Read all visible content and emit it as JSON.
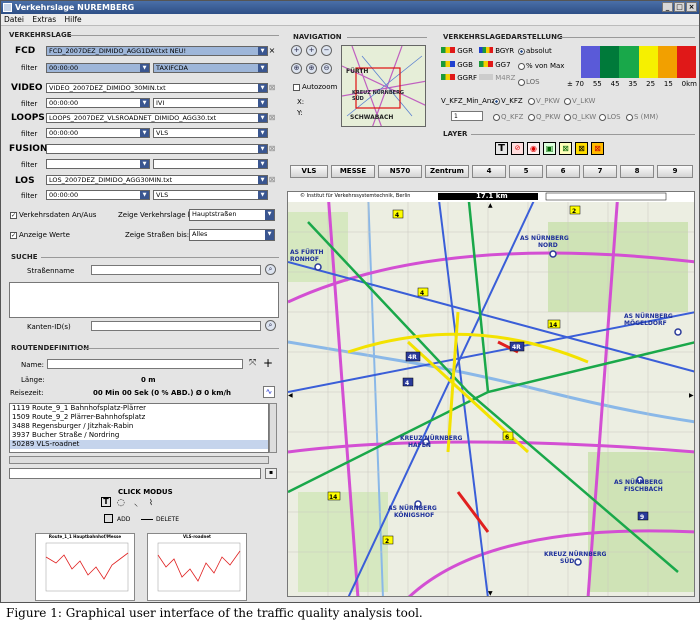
{
  "window": {
    "title": "Verkehrslage NUREMBERG",
    "min": "_",
    "max": "□",
    "close": "×"
  },
  "menu": [
    "Datei",
    "Extras",
    "Hilfe"
  ],
  "verkehrslage": {
    "title": "VERKEHRSLAGE",
    "fcd": {
      "label": "FCD",
      "source": "FCD_2007DEZ_DIMIDO_AGG1DAY.txt NEU!",
      "filter_label": "filter",
      "time": "00:00:00",
      "mode": "TAXIFCDA"
    },
    "video": {
      "label": "VIDEO",
      "source": "VIDEO_2007DEZ_DIMIDO_30MIN.txt",
      "filter_label": "filter",
      "time": "00:00:00",
      "mode": "IVI"
    },
    "loops": {
      "label": "LOOPS",
      "source": "LOOPS_2007DEZ_VLSROADNET_DIMIDO_AGG30.txt",
      "filter_label": "filter",
      "time": "00:00:00",
      "mode": "VLS"
    },
    "fusion": {
      "label": "FUSION",
      "source": "",
      "filter_label": "filter",
      "time": "",
      "mode": ""
    },
    "los": {
      "label": "LOS",
      "source": "LOS_2007DEZ_DIMIDO_AGG30MIN.txt",
      "filter_label": "filter",
      "time": "00:00:00",
      "mode": "VLS"
    },
    "show_data": "Verkehrsdaten An/Aus",
    "show_until_label": "Zeige Verkehrslage bis:",
    "show_until_value": "Hauptstraßen",
    "show_values": "Anzeige Werte",
    "show_roads_label": "Zeige Straßen bis:",
    "show_roads_value": "Alles"
  },
  "suche": {
    "title": "SUCHE",
    "street_label": "Straßenname",
    "kanten_label": "Kanten-ID(s)"
  },
  "route": {
    "title": "ROUTENDEFINITION",
    "name_label": "Name:",
    "length_label": "Länge:",
    "length_value": "0 m",
    "time_label": "Reisezeit:",
    "time_value": "00 Min 00 Sek (0 % ABD.)  Ø 0 km/h",
    "items": [
      "1119 Route_9_1 Bahnhofsplatz-Plärrer",
      "1509 Route_9_2 Plärrer-Bahnhofsplatz",
      "3488 Regensburger / Jitzhak-Rabin",
      "3937 Bucher Straße / Nordring",
      "50289 VLS-roadnet"
    ]
  },
  "click_modus": {
    "title": "CLICK MODUS",
    "add": "ADD",
    "delete": "DELETE"
  },
  "thumbs": [
    {
      "title": "Route_1_1 Hauptbahnhof/Messe"
    },
    {
      "title": "VLS-roadnet"
    }
  ],
  "navigation": {
    "title": "NAVIGATION",
    "autozoom": "Autozoom",
    "x_label": "X:",
    "y_label": "Y:",
    "mini_labels": [
      "FÜRTH",
      "KREUZ NÜRNBERG SÜD",
      "SCHWABACH"
    ]
  },
  "darstellung": {
    "title": "VERKEHRSLAGEDARSTELLUNG",
    "legend_row1": [
      "GGR",
      "BGYR"
    ],
    "legend_row2": [
      "GGB",
      "GG7"
    ],
    "legend_row3": [
      "GGRF",
      "M4RZ"
    ],
    "radio_absolut": "absolut",
    "radio_percent": "% von Max",
    "radio_los": "LOS",
    "scale_ticks": [
      "± 70",
      "55",
      "45",
      "35",
      "25",
      "15",
      "0km"
    ],
    "vkfz_label": "V_KFZ_Min_Anz",
    "v_radios": [
      "V_KFZ",
      "V_PKW",
      "V_LKW"
    ],
    "q_radios": [
      "Q_KFZ",
      "Q_PKW",
      "Q_LKW",
      "LOS",
      "S (MM)"
    ],
    "spinner_value": "1",
    "colors": {
      "blue": "#5a5ad8",
      "green_dark": "#007a3a",
      "green": "#19a84a",
      "yellow": "#f6f000",
      "orange": "#f2a000",
      "red": "#e01818"
    }
  },
  "layer": {
    "title": "LAYER"
  },
  "map_buttons": [
    "VLS",
    "MESSE",
    "N570",
    "Zentrum",
    "4",
    "5",
    "6",
    "7",
    "8",
    "9"
  ],
  "map": {
    "attribution": "© Institut für Verkehrssystemtechnik, Berlin",
    "scale": "17.1 km",
    "places": [
      "AS FÜRTH RONHOF",
      "AS NÜRNBERG NORD",
      "AS NÜRNBERG MÖGELDORF",
      "KREUZ NÜRNBERG HAFEN",
      "AS NÜRNBERG FISCHBACH",
      "AS NÜRNBERG KÖNIGSHOF",
      "KREUZ NÜRNBERG SÜD"
    ]
  },
  "caption": "Figure 1: Graphical user interface of the traffic quality analysis tool."
}
